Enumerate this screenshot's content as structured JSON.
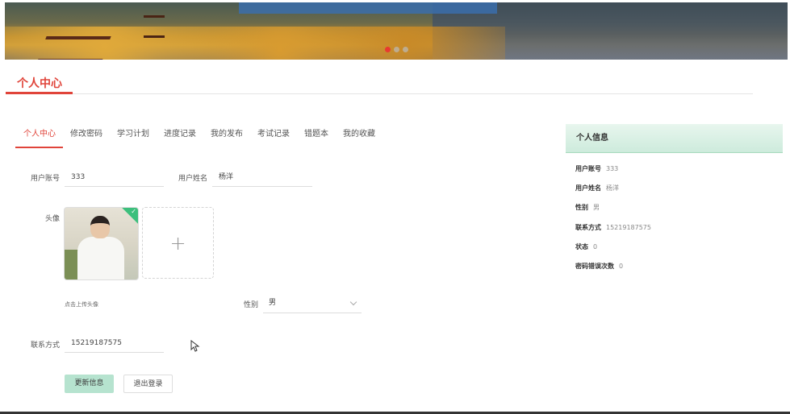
{
  "header": {
    "title": "个人中心"
  },
  "tabs": [
    {
      "label": "个人中心",
      "active": true
    },
    {
      "label": "修改密码",
      "active": false
    },
    {
      "label": "学习计划",
      "active": false
    },
    {
      "label": "进度记录",
      "active": false
    },
    {
      "label": "我的发布",
      "active": false
    },
    {
      "label": "考试记录",
      "active": false
    },
    {
      "label": "错题本",
      "active": false
    },
    {
      "label": "我的收藏",
      "active": false
    }
  ],
  "form": {
    "account_label": "用户账号",
    "account_value": "333",
    "name_label": "用户姓名",
    "name_value": "杨洋",
    "avatar_label": "头像",
    "upload_plus": "+",
    "upload_hint": "点击上传头像",
    "gender_label": "性别",
    "gender_value": "男",
    "contact_label": "联系方式",
    "contact_value": "15219187575",
    "update_button": "更新信息",
    "logout_button": "退出登录"
  },
  "info_panel": {
    "title": "个人信息",
    "rows": [
      {
        "key": "用户账号",
        "value": "333"
      },
      {
        "key": "用户姓名",
        "value": "杨洋"
      },
      {
        "key": "性别",
        "value": "男"
      },
      {
        "key": "联系方式",
        "value": "15219187575"
      },
      {
        "key": "状态",
        "value": "0"
      },
      {
        "key": "密码错误次数",
        "value": "0"
      }
    ]
  },
  "carousel": {
    "slides": 3,
    "active_index": 0
  },
  "colors": {
    "accent": "#e0443a",
    "success": "#3cbf7c",
    "primary_button": "#b6e3cf"
  }
}
